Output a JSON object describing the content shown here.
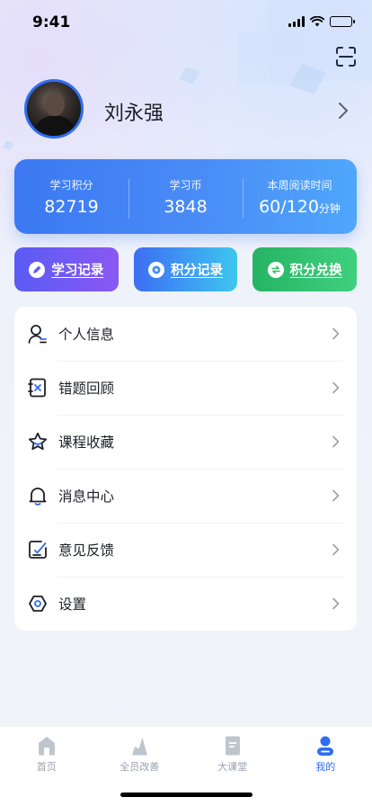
{
  "status_bar": {
    "time": "9:41"
  },
  "profile": {
    "name": "刘永强"
  },
  "stats": [
    {
      "label": "学习积分",
      "value": "82719",
      "unit": ""
    },
    {
      "label": "学习币",
      "value": "3848",
      "unit": ""
    },
    {
      "label": "本周阅读时间",
      "value": "60/120",
      "unit": "分钟"
    }
  ],
  "actions": [
    {
      "label": "学习记录",
      "icon": "pen-icon",
      "color": "#6a5af4"
    },
    {
      "label": "积分记录",
      "icon": "medal-icon",
      "color": "#3e8ef2"
    },
    {
      "label": "积分兑换",
      "icon": "exchange-icon",
      "color": "#2fbe6e"
    }
  ],
  "menu": [
    {
      "label": "个人信息",
      "icon": "user-icon"
    },
    {
      "label": "错题回顾",
      "icon": "wrong-question-icon"
    },
    {
      "label": "课程收藏",
      "icon": "star-icon"
    },
    {
      "label": "消息中心",
      "icon": "bell-icon"
    },
    {
      "label": "意见反馈",
      "icon": "feedback-icon"
    },
    {
      "label": "设置",
      "icon": "settings-icon"
    }
  ],
  "tabs": [
    {
      "label": "首页",
      "icon": "home-icon",
      "active": false
    },
    {
      "label": "全员改善",
      "icon": "improve-icon",
      "active": false
    },
    {
      "label": "大课堂",
      "icon": "classroom-icon",
      "active": false
    },
    {
      "label": "我的",
      "icon": "profile-icon",
      "active": true
    }
  ],
  "colors": {
    "accent": "#2f6df0",
    "stats_card_start": "#3b78f2",
    "stats_card_end": "#4fa7fb"
  }
}
